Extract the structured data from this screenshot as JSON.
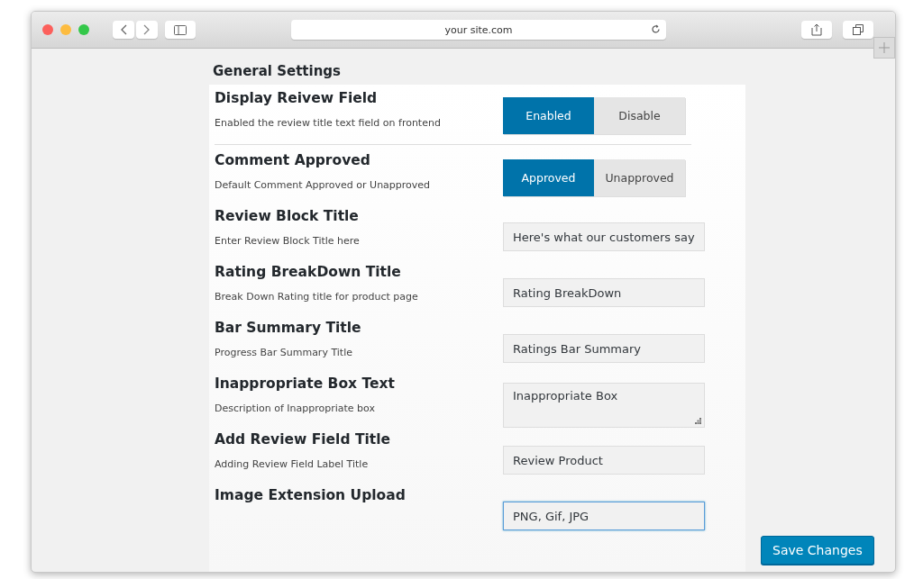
{
  "browser": {
    "address": "your site.com"
  },
  "page": {
    "title": "General Settings"
  },
  "settings": [
    {
      "kind": "toggle",
      "label": "Display Reivew Field",
      "description": "Enabled the review title text field on frontend",
      "options": [
        {
          "label": "Enabled",
          "selected": true
        },
        {
          "label": "Disable",
          "selected": false
        }
      ]
    },
    {
      "kind": "toggle",
      "label": "Comment Approved",
      "description": "Default Comment Approved or Unapproved",
      "options": [
        {
          "label": "Approved",
          "selected": true
        },
        {
          "label": "Unapproved",
          "selected": false
        }
      ]
    },
    {
      "kind": "text",
      "label": "Review Block Title",
      "description": "Enter Review Block Title here",
      "value": "Here's what our customers say",
      "focused": false
    },
    {
      "kind": "text",
      "label": "Rating BreakDown Title",
      "description": "Break Down Rating title for product page",
      "value": "Rating BreakDown",
      "focused": false
    },
    {
      "kind": "text",
      "label": "Bar Summary Title",
      "description": "Progress Bar Summary Title",
      "value": "Ratings Bar Summary",
      "focused": false
    },
    {
      "kind": "textarea",
      "label": "Inappropriate Box Text",
      "description": "Description of Inappropriate box",
      "value": "Inappropriate Box",
      "focused": false
    },
    {
      "kind": "text",
      "label": "Add Review Field Title",
      "description": "Adding Review Field Label Title",
      "value": "Review Product",
      "focused": false
    },
    {
      "kind": "text",
      "label": "Image Extension Upload",
      "value": "PNG, Gif, JPG",
      "focused": true
    }
  ],
  "save_button": "Save Changes"
}
